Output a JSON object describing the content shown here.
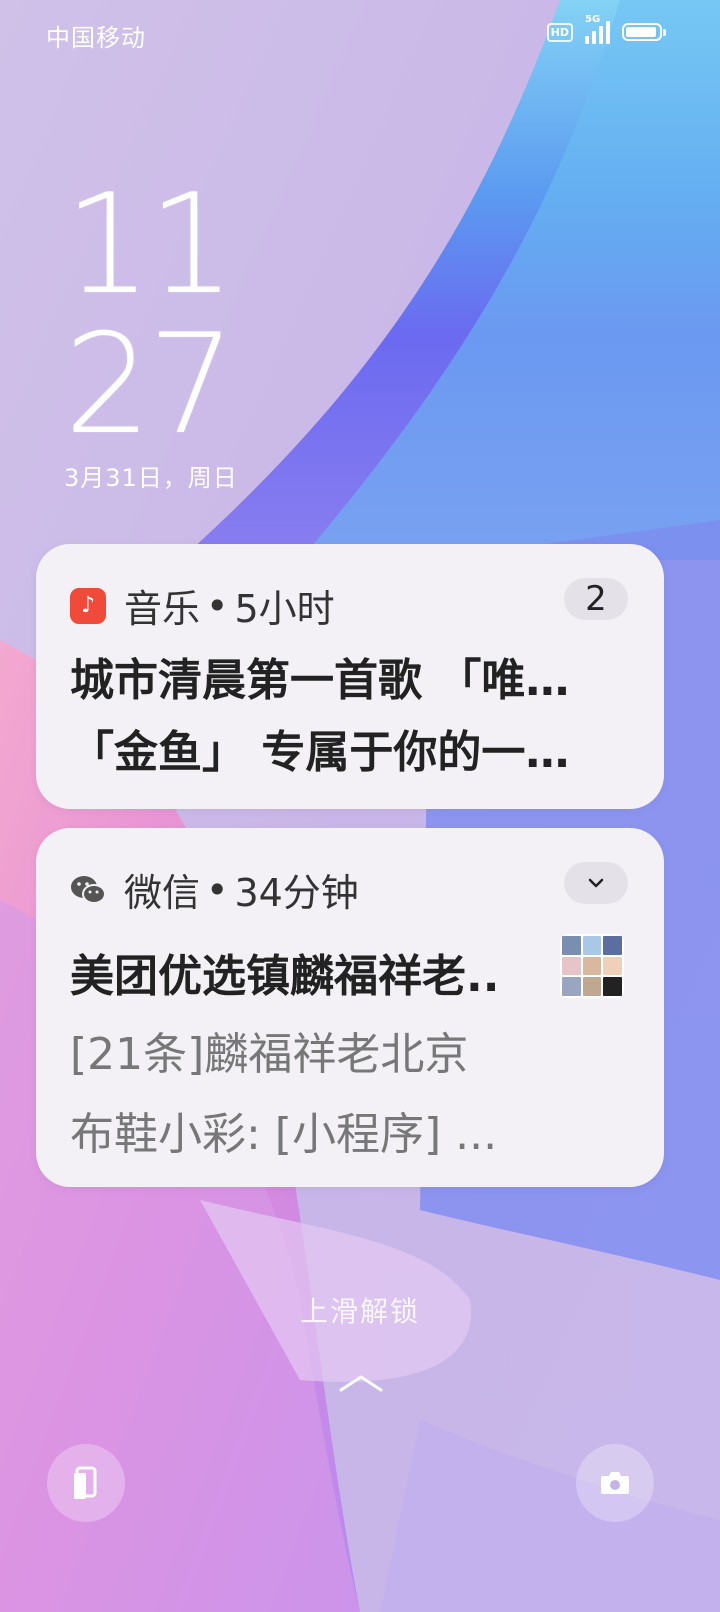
{
  "status_bar": {
    "carrier": "中国移动",
    "hd_label": "HD",
    "network": "5G",
    "battery_level": 0.95
  },
  "lockscreen": {
    "hour": "11",
    "minute": "27",
    "date": "3月31日，周日",
    "unlock_hint": "上滑解锁"
  },
  "notifications": [
    {
      "app": "音乐",
      "time": "5小时",
      "count": "2",
      "title": "城市清晨第一首歌 「唯…",
      "body": "「金鱼」 专属于你的一…",
      "icon": "music-note-icon"
    },
    {
      "app": "微信",
      "time": "34分钟",
      "title": "美团优选镇麟福祥老..",
      "body_line1": "[21条]麟福祥老北京",
      "body_line2": "布鞋小彩: [小程序] ...",
      "icon": "wechat-icon",
      "expand_icon": "chevron-down-icon"
    }
  ],
  "separator": "•",
  "shortcuts": {
    "left_icon": "wallet-card-icon",
    "right_icon": "camera-icon"
  },
  "colors": {
    "card_bg": "#f3f1f6",
    "music_red": "#f04a3a"
  }
}
